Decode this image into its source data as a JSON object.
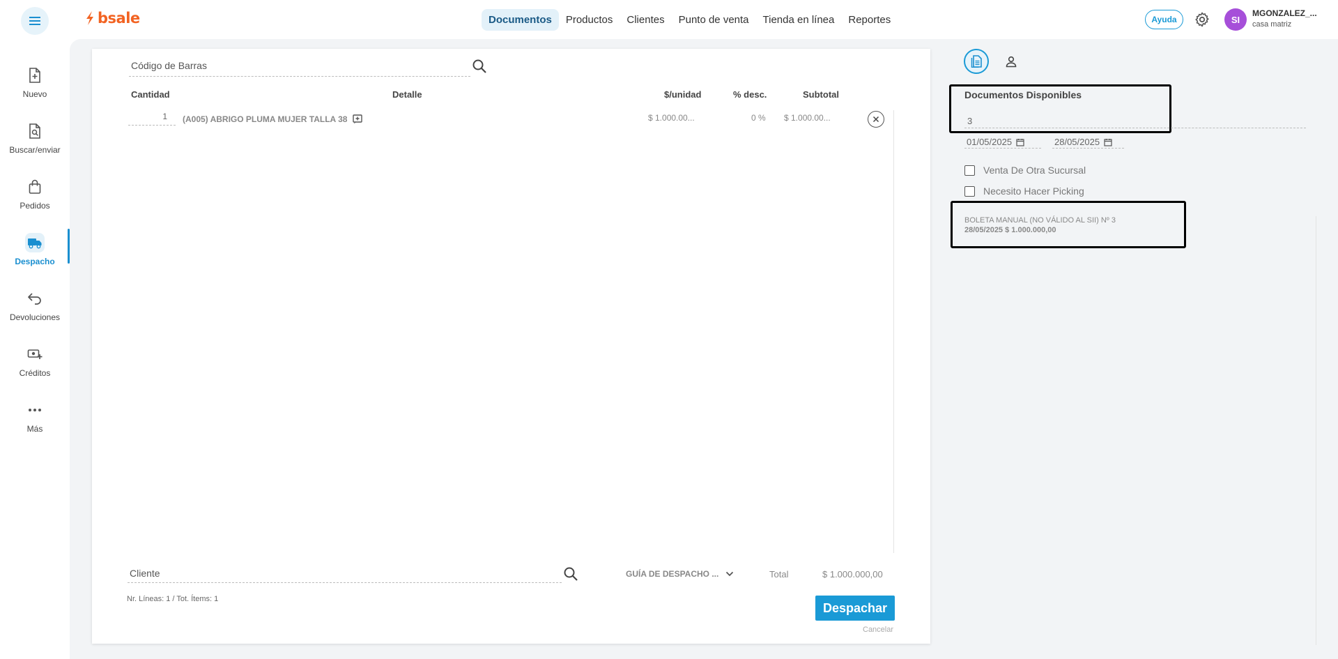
{
  "app": {
    "logo_text": "bsale",
    "brand_color": "#f26322",
    "accent_color": "#1a9ad6"
  },
  "nav": {
    "items": [
      {
        "label": "Documentos",
        "active": true
      },
      {
        "label": "Productos"
      },
      {
        "label": "Clientes"
      },
      {
        "label": "Punto de venta"
      },
      {
        "label": "Tienda en línea"
      },
      {
        "label": "Reportes"
      }
    ]
  },
  "header": {
    "help_label": "Ayuda",
    "avatar_initials": "SI",
    "user_name": "MGONZALEZ_...",
    "branch": "casa matriz"
  },
  "sidebar": {
    "items": [
      {
        "label": "Nuevo",
        "icon": "file-plus-icon"
      },
      {
        "label": "Buscar/enviar",
        "icon": "file-search-icon"
      },
      {
        "label": "Pedidos",
        "icon": "shopping-bag-icon"
      },
      {
        "label": "Despacho",
        "icon": "truck-icon",
        "active": true
      },
      {
        "label": "Devoluciones",
        "icon": "return-arrow-icon"
      },
      {
        "label": "Créditos",
        "icon": "money-plus-icon"
      },
      {
        "label": "Más",
        "icon": "more-dots-icon"
      }
    ]
  },
  "document": {
    "barcode_placeholder": "Código de Barras",
    "columns": {
      "quantity": "Cantidad",
      "detail": "Detalle",
      "unit_price": "$/unidad",
      "discount": "% desc.",
      "subtotal": "Subtotal"
    },
    "lines": [
      {
        "quantity": "1",
        "detail": "(A005) ABRIGO PLUMA MUJER TALLA 38",
        "unit_price": "$ 1.000.00...",
        "discount": "0 %",
        "subtotal": "$ 1.000.00..."
      }
    ],
    "client_placeholder": "Cliente",
    "doc_type": "GUÍA DE DESPACHO ...",
    "total_label": "Total",
    "total_value": "$ 1.000.000,00",
    "lines_info": "Nr. Líneas: 1 / Tot. Ítems: 1",
    "dispatch_label": "Despachar",
    "cancel_label": "Cancelar"
  },
  "panel": {
    "title": "Documentos Disponibles",
    "doc_number": "3",
    "date_from": "01/05/2025",
    "date_to": "28/05/2025",
    "checkboxes": [
      {
        "label": "Venta De Otra Sucursal",
        "checked": false
      },
      {
        "label": "Necesito Hacer Picking",
        "checked": false
      }
    ],
    "results": [
      {
        "line1": "BOLETA MANUAL (NO VÁLIDO AL SII) Nº 3",
        "line2": "28/05/2025 $ 1.000.000,00"
      }
    ]
  }
}
